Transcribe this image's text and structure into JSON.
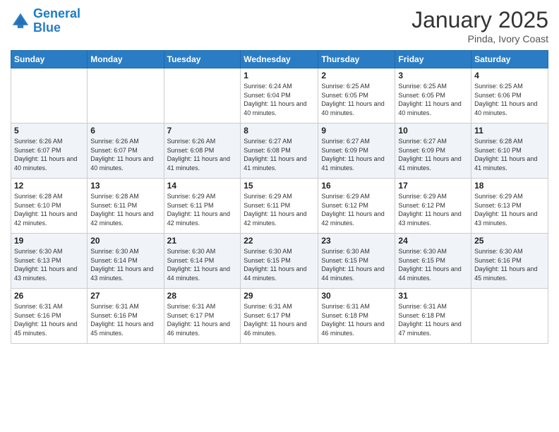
{
  "logo": {
    "line1": "General",
    "line2": "Blue"
  },
  "title": {
    "month_year": "January 2025",
    "location": "Pinda, Ivory Coast"
  },
  "weekdays": [
    "Sunday",
    "Monday",
    "Tuesday",
    "Wednesday",
    "Thursday",
    "Friday",
    "Saturday"
  ],
  "weeks": [
    [
      {
        "day": "",
        "info": ""
      },
      {
        "day": "",
        "info": ""
      },
      {
        "day": "",
        "info": ""
      },
      {
        "day": "1",
        "info": "Sunrise: 6:24 AM\nSunset: 6:04 PM\nDaylight: 11 hours and 40 minutes."
      },
      {
        "day": "2",
        "info": "Sunrise: 6:25 AM\nSunset: 6:05 PM\nDaylight: 11 hours and 40 minutes."
      },
      {
        "day": "3",
        "info": "Sunrise: 6:25 AM\nSunset: 6:05 PM\nDaylight: 11 hours and 40 minutes."
      },
      {
        "day": "4",
        "info": "Sunrise: 6:25 AM\nSunset: 6:06 PM\nDaylight: 11 hours and 40 minutes."
      }
    ],
    [
      {
        "day": "5",
        "info": "Sunrise: 6:26 AM\nSunset: 6:07 PM\nDaylight: 11 hours and 40 minutes."
      },
      {
        "day": "6",
        "info": "Sunrise: 6:26 AM\nSunset: 6:07 PM\nDaylight: 11 hours and 40 minutes."
      },
      {
        "day": "7",
        "info": "Sunrise: 6:26 AM\nSunset: 6:08 PM\nDaylight: 11 hours and 41 minutes."
      },
      {
        "day": "8",
        "info": "Sunrise: 6:27 AM\nSunset: 6:08 PM\nDaylight: 11 hours and 41 minutes."
      },
      {
        "day": "9",
        "info": "Sunrise: 6:27 AM\nSunset: 6:09 PM\nDaylight: 11 hours and 41 minutes."
      },
      {
        "day": "10",
        "info": "Sunrise: 6:27 AM\nSunset: 6:09 PM\nDaylight: 11 hours and 41 minutes."
      },
      {
        "day": "11",
        "info": "Sunrise: 6:28 AM\nSunset: 6:10 PM\nDaylight: 11 hours and 41 minutes."
      }
    ],
    [
      {
        "day": "12",
        "info": "Sunrise: 6:28 AM\nSunset: 6:10 PM\nDaylight: 11 hours and 42 minutes."
      },
      {
        "day": "13",
        "info": "Sunrise: 6:28 AM\nSunset: 6:11 PM\nDaylight: 11 hours and 42 minutes."
      },
      {
        "day": "14",
        "info": "Sunrise: 6:29 AM\nSunset: 6:11 PM\nDaylight: 11 hours and 42 minutes."
      },
      {
        "day": "15",
        "info": "Sunrise: 6:29 AM\nSunset: 6:11 PM\nDaylight: 11 hours and 42 minutes."
      },
      {
        "day": "16",
        "info": "Sunrise: 6:29 AM\nSunset: 6:12 PM\nDaylight: 11 hours and 42 minutes."
      },
      {
        "day": "17",
        "info": "Sunrise: 6:29 AM\nSunset: 6:12 PM\nDaylight: 11 hours and 43 minutes."
      },
      {
        "day": "18",
        "info": "Sunrise: 6:29 AM\nSunset: 6:13 PM\nDaylight: 11 hours and 43 minutes."
      }
    ],
    [
      {
        "day": "19",
        "info": "Sunrise: 6:30 AM\nSunset: 6:13 PM\nDaylight: 11 hours and 43 minutes."
      },
      {
        "day": "20",
        "info": "Sunrise: 6:30 AM\nSunset: 6:14 PM\nDaylight: 11 hours and 43 minutes."
      },
      {
        "day": "21",
        "info": "Sunrise: 6:30 AM\nSunset: 6:14 PM\nDaylight: 11 hours and 44 minutes."
      },
      {
        "day": "22",
        "info": "Sunrise: 6:30 AM\nSunset: 6:15 PM\nDaylight: 11 hours and 44 minutes."
      },
      {
        "day": "23",
        "info": "Sunrise: 6:30 AM\nSunset: 6:15 PM\nDaylight: 11 hours and 44 minutes."
      },
      {
        "day": "24",
        "info": "Sunrise: 6:30 AM\nSunset: 6:15 PM\nDaylight: 11 hours and 44 minutes."
      },
      {
        "day": "25",
        "info": "Sunrise: 6:30 AM\nSunset: 6:16 PM\nDaylight: 11 hours and 45 minutes."
      }
    ],
    [
      {
        "day": "26",
        "info": "Sunrise: 6:31 AM\nSunset: 6:16 PM\nDaylight: 11 hours and 45 minutes."
      },
      {
        "day": "27",
        "info": "Sunrise: 6:31 AM\nSunset: 6:16 PM\nDaylight: 11 hours and 45 minutes."
      },
      {
        "day": "28",
        "info": "Sunrise: 6:31 AM\nSunset: 6:17 PM\nDaylight: 11 hours and 46 minutes."
      },
      {
        "day": "29",
        "info": "Sunrise: 6:31 AM\nSunset: 6:17 PM\nDaylight: 11 hours and 46 minutes."
      },
      {
        "day": "30",
        "info": "Sunrise: 6:31 AM\nSunset: 6:18 PM\nDaylight: 11 hours and 46 minutes."
      },
      {
        "day": "31",
        "info": "Sunrise: 6:31 AM\nSunset: 6:18 PM\nDaylight: 11 hours and 47 minutes."
      },
      {
        "day": "",
        "info": ""
      }
    ]
  ]
}
